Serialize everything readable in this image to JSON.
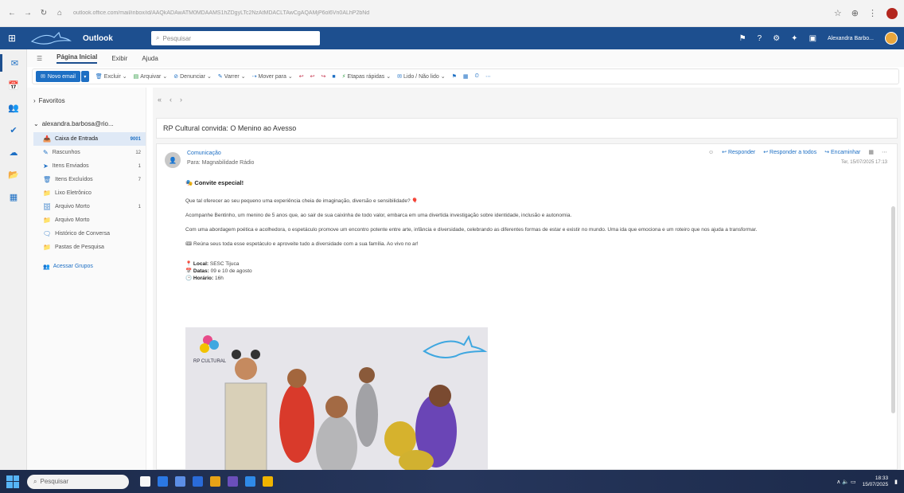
{
  "browser": {
    "nav": [
      "←",
      "→",
      "↻",
      "⌂"
    ],
    "url": "outlook.office.com/mail/inbox/id/AAQkADAwATM0MDAAMS1hZDgyLTc2NzAtMDACLTAwCgAQAMjP6ol6Vn0ALhP2bNd",
    "right_icons": [
      "☆",
      "⊕",
      "⋮"
    ]
  },
  "outlook_header": {
    "brand": "Outlook",
    "search_placeholder": "Pesquisar",
    "icons": [
      "▣",
      "✦",
      "⚙",
      "?",
      "⚑"
    ],
    "user_name": "Alexandra Barbo..."
  },
  "ribbon_tabs": [
    "Página Inicial",
    "Exibir",
    "Ajuda"
  ],
  "ribbon": {
    "new_mail": "Novo email",
    "items": [
      {
        "icon": "🗑",
        "label": "Excluir",
        "tone": "blue"
      },
      {
        "icon": "▤",
        "label": "Arquivar",
        "tone": "green"
      },
      {
        "icon": "⊘",
        "label": "Denunciar",
        "tone": "blue"
      },
      {
        "icon": "✎",
        "label": "Varrer",
        "tone": "blue"
      },
      {
        "icon": "⇢",
        "label": "Mover para",
        "tone": "blue"
      },
      {
        "icon": "↩",
        "label": "",
        "tone": "red"
      },
      {
        "icon": "↩",
        "label": "",
        "tone": "red"
      },
      {
        "icon": "↪",
        "label": "",
        "tone": "red"
      },
      {
        "icon": "■",
        "label": "",
        "tone": "blue"
      },
      {
        "icon": "⚡",
        "label": "Etapas rápidas",
        "tone": "green"
      },
      {
        "icon": "✉",
        "label": "Lido / Não lido",
        "tone": "blue"
      },
      {
        "icon": "⚑",
        "label": "",
        "tone": "blue"
      },
      {
        "icon": "▦",
        "label": "",
        "tone": "blue"
      },
      {
        "icon": "⏲",
        "label": "",
        "tone": "blue"
      },
      {
        "icon": "⋯",
        "label": "",
        "tone": "blue"
      }
    ]
  },
  "app_rail": [
    "✉",
    "📅",
    "👥",
    "✔",
    "☁",
    "📂",
    "▦"
  ],
  "folders": {
    "favorites_label": "Favoritos",
    "account_label": "alexandra.barbosa@rio...",
    "items": [
      {
        "icon": "📥",
        "label": "Caixa de Entrada",
        "count": "9001",
        "active": true
      },
      {
        "icon": "✎",
        "label": "Rascunhos",
        "count": "12",
        "active": false
      },
      {
        "icon": "➤",
        "label": "Itens Enviados",
        "count": "1",
        "active": false
      },
      {
        "icon": "🗑",
        "label": "Itens Excluídos",
        "count": "7",
        "active": false
      },
      {
        "icon": "📁",
        "label": "Lixo Eletrônico",
        "count": "",
        "active": false
      },
      {
        "icon": "🗄",
        "label": "Arquivo Morto",
        "count": "1",
        "active": false
      },
      {
        "icon": "📁",
        "label": "Arquivo Morto",
        "count": "",
        "active": false
      },
      {
        "icon": "🗨",
        "label": "Histórico de Conversa",
        "count": "",
        "active": false
      },
      {
        "icon": "📁",
        "label": "Pastas de Pesquisa",
        "count": "",
        "active": false
      }
    ],
    "groups_link": "Acessar Grupos"
  },
  "reading": {
    "nav_arrows": [
      "«",
      "‹",
      "›"
    ],
    "subject": "RP Cultural convida: O Menino ao Avesso",
    "sender": "Comunicação",
    "to": "Para: Magnabilidade Rádio",
    "actions": [
      "Responder",
      "Responder a todos",
      "Encaminhar"
    ],
    "date": "Ter, 15/07/2025 17:13",
    "headline": "🎭 Convite especial!",
    "paragraphs": [
      "Que tal oferecer ao seu pequeno uma experiência cheia de imaginação, diversão e sensibilidade? 🎈",
      "Acompanhe Bentinho, um menino de 5 anos que, ao sair de sua caixinha de todo valor, embarca em uma divertida investigação sobre identidade, inclusão e autonomia.",
      "Com uma abordagem poética e acolhedora, o espetáculo promove um encontro potente entre arte, infância e diversidade, celebrando as diferentes formas de estar e existir no mundo. Uma ida que emociona e um roteiro que nos ajuda a transformar.",
      "🎟 Reúna seus toda esse espetáculo e aproveite tudo a diversidade com a sua família. Ao vivo no ar!"
    ],
    "details": [
      {
        "icon": "📍",
        "label": "Local:",
        "value": "SESC Tijuca"
      },
      {
        "icon": "📅",
        "label": "Datas:",
        "value": "09 e 10 de agosto"
      },
      {
        "icon": "🕒",
        "label": "Horário:",
        "value": "16h"
      }
    ],
    "poster_brand": "RP CULTURAL"
  },
  "taskbar": {
    "search_placeholder": "Pesquisar",
    "apps": [
      {
        "color": "#f7f7f7"
      },
      {
        "color": "#2b78e4"
      },
      {
        "color": "#5c8ee6"
      },
      {
        "color": "#2a6bd9"
      },
      {
        "color": "#e8a317"
      },
      {
        "color": "#6b4fbb"
      },
      {
        "color": "#2f8ae8"
      },
      {
        "color": "#f0b400"
      }
    ],
    "tray": "∧  🔈  ▭",
    "time": "18:33",
    "date": "15/07/2025"
  }
}
